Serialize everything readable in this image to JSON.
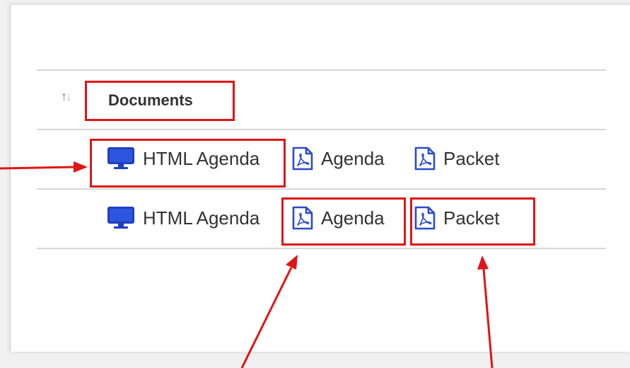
{
  "table": {
    "header": {
      "sort_icon": "sort-arrows-icon",
      "documents_label": "Documents"
    },
    "rows": [
      {
        "html_agenda_label": "HTML Agenda",
        "agenda_label": "Agenda",
        "packet_label": "Packet"
      },
      {
        "html_agenda_label": "HTML Agenda",
        "agenda_label": "Agenda",
        "packet_label": "Packet"
      }
    ]
  },
  "icons": {
    "html": "monitor-icon",
    "pdf": "pdf-file-icon"
  },
  "colors": {
    "monitor_blue": "#1f3fbf",
    "pdf_blue": "#2a4bcc",
    "highlight_red": "#e01515"
  }
}
